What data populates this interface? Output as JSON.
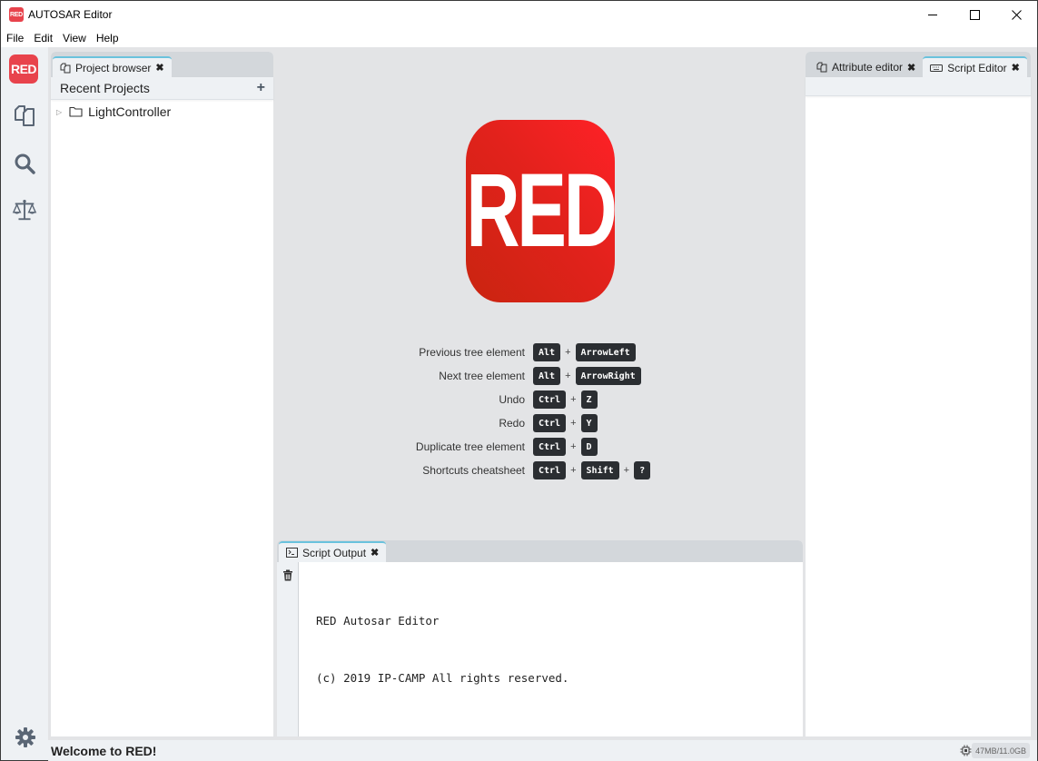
{
  "window": {
    "title": "AUTOSAR Editor",
    "app_icon_text": "RED",
    "controls": [
      "minimize",
      "maximize",
      "close"
    ]
  },
  "menu": {
    "items": [
      {
        "label": "File"
      },
      {
        "label": "Edit"
      },
      {
        "label": "View"
      },
      {
        "label": "Help"
      }
    ]
  },
  "activitybar": {
    "logo_text": "RED",
    "items": [
      {
        "icon": "copy-documents-icon",
        "label": "Project browser"
      },
      {
        "icon": "search-icon",
        "label": "Search"
      },
      {
        "icon": "scale-icon",
        "label": "Compare"
      }
    ],
    "settings_icon": "gear-icon"
  },
  "left_panel": {
    "tabs": [
      {
        "label": "Project browser",
        "icon": "copy-documents-icon",
        "active": true,
        "closable": true
      }
    ],
    "header": {
      "title": "Recent Projects",
      "action": "+"
    },
    "tree": [
      {
        "label": "LightController",
        "icon": "folder-icon",
        "expanded": false
      }
    ]
  },
  "right_panel": {
    "tabs": [
      {
        "label": "Attribute editor",
        "icon": "copy-documents-icon",
        "active": false,
        "closable": true
      },
      {
        "label": "Script Editor",
        "icon": "keyboard-icon",
        "active": true,
        "closable": true
      }
    ]
  },
  "welcome": {
    "logo_text": "RED",
    "shortcuts": [
      {
        "label": "Previous tree element",
        "keys": [
          "Alt",
          "ArrowLeft"
        ]
      },
      {
        "label": "Next tree element",
        "keys": [
          "Alt",
          "ArrowRight"
        ]
      },
      {
        "label": "Undo",
        "keys": [
          "Ctrl",
          "Z"
        ]
      },
      {
        "label": "Redo",
        "keys": [
          "Ctrl",
          "Y"
        ]
      },
      {
        "label": "Duplicate tree element",
        "keys": [
          "Ctrl",
          "D"
        ]
      },
      {
        "label": "Shortcuts cheatsheet",
        "keys": [
          "Ctrl",
          "Shift",
          "?"
        ]
      }
    ],
    "key_separator": "+"
  },
  "output_panel": {
    "tabs": [
      {
        "label": "Script Output",
        "icon": "terminal-icon",
        "active": true,
        "closable": true
      }
    ],
    "clear_icon": "trash-icon",
    "lines": [
      "RED Autosar Editor",
      "(c) 2019 IP-CAMP All rights reserved."
    ]
  },
  "statusbar": {
    "message": "Welcome to RED!",
    "memory": "47MB/11.0GB",
    "memory_icon": "chip-icon"
  },
  "colors": {
    "brand_red": "#e8434c",
    "logo_red": "#e2221c",
    "tab_accent": "#6ac2dd",
    "kbd_bg": "#2b2e32"
  }
}
